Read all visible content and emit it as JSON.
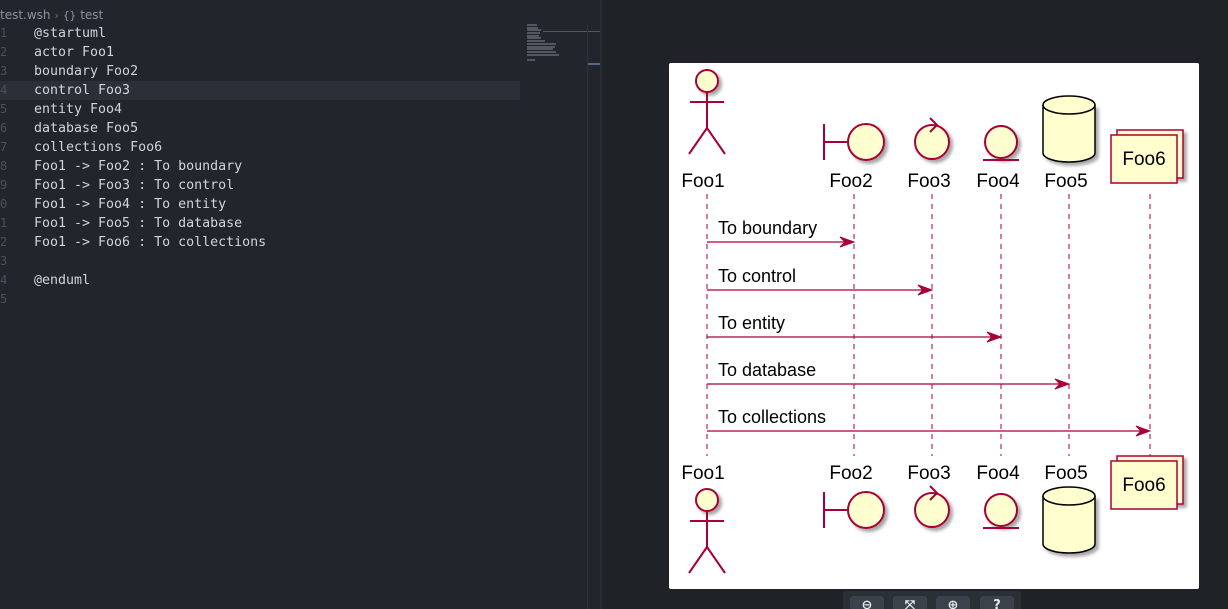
{
  "breadcrumb": {
    "file": "test.wsh",
    "symbol": "test"
  },
  "editor": {
    "lines": [
      {
        "num": "1",
        "code": "@startuml"
      },
      {
        "num": "2",
        "code": "actor Foo1"
      },
      {
        "num": "3",
        "code": "boundary Foo2"
      },
      {
        "num": "4",
        "code": "control Foo3"
      },
      {
        "num": "5",
        "code": "entity Foo4"
      },
      {
        "num": "6",
        "code": "database Foo5"
      },
      {
        "num": "7",
        "code": "collections Foo6"
      },
      {
        "num": "8",
        "code": "Foo1 -> Foo2 : To boundary"
      },
      {
        "num": "9",
        "code": "Foo1 -> Foo3 : To control"
      },
      {
        "num": "0",
        "code": "Foo1 -> Foo4 : To entity"
      },
      {
        "num": "1",
        "code": "Foo1 -> Foo5 : To database"
      },
      {
        "num": "2",
        "code": "Foo1 -> Foo6 : To collections"
      },
      {
        "num": "3",
        "code": ""
      },
      {
        "num": "4",
        "code": "@enduml"
      },
      {
        "num": "5",
        "code": ""
      }
    ],
    "current_line_index": 3
  },
  "diagram": {
    "participants": [
      {
        "id": "foo1",
        "kind": "actor",
        "name": "Foo1"
      },
      {
        "id": "foo2",
        "kind": "boundary",
        "name": "Foo2"
      },
      {
        "id": "foo3",
        "kind": "control",
        "name": "Foo3"
      },
      {
        "id": "foo4",
        "kind": "entity",
        "name": "Foo4"
      },
      {
        "id": "foo5",
        "kind": "database",
        "name": "Foo5"
      },
      {
        "id": "foo6",
        "kind": "collections",
        "name": "Foo6"
      }
    ],
    "messages": [
      {
        "from": "foo1",
        "to": "foo2",
        "label": "To boundary"
      },
      {
        "from": "foo1",
        "to": "foo3",
        "label": "To control"
      },
      {
        "from": "foo1",
        "to": "foo4",
        "label": "To entity"
      },
      {
        "from": "foo1",
        "to": "foo5",
        "label": "To database"
      },
      {
        "from": "foo1",
        "to": "foo6",
        "label": "To collections"
      }
    ],
    "colors": {
      "stroke": "#a80036",
      "fill": "#fefece",
      "text": "#000000",
      "lifeline": "#a80036"
    }
  },
  "toolbar": {
    "buttons": [
      {
        "name": "zoom-out-button",
        "icon": "zoom-out-icon",
        "glyph": "⊖"
      },
      {
        "name": "zoom-fit-button",
        "icon": "fit-icon",
        "glyph": "⤧"
      },
      {
        "name": "zoom-in-button",
        "icon": "zoom-in-icon",
        "glyph": "⊕"
      },
      {
        "name": "help-button",
        "icon": "help-icon",
        "glyph": "?"
      }
    ]
  },
  "colors": {
    "editor_bg": "#22262c",
    "preview_bg": "#1f2328",
    "canvas_bg": "#ffffff",
    "current_line": "#2b3038"
  }
}
